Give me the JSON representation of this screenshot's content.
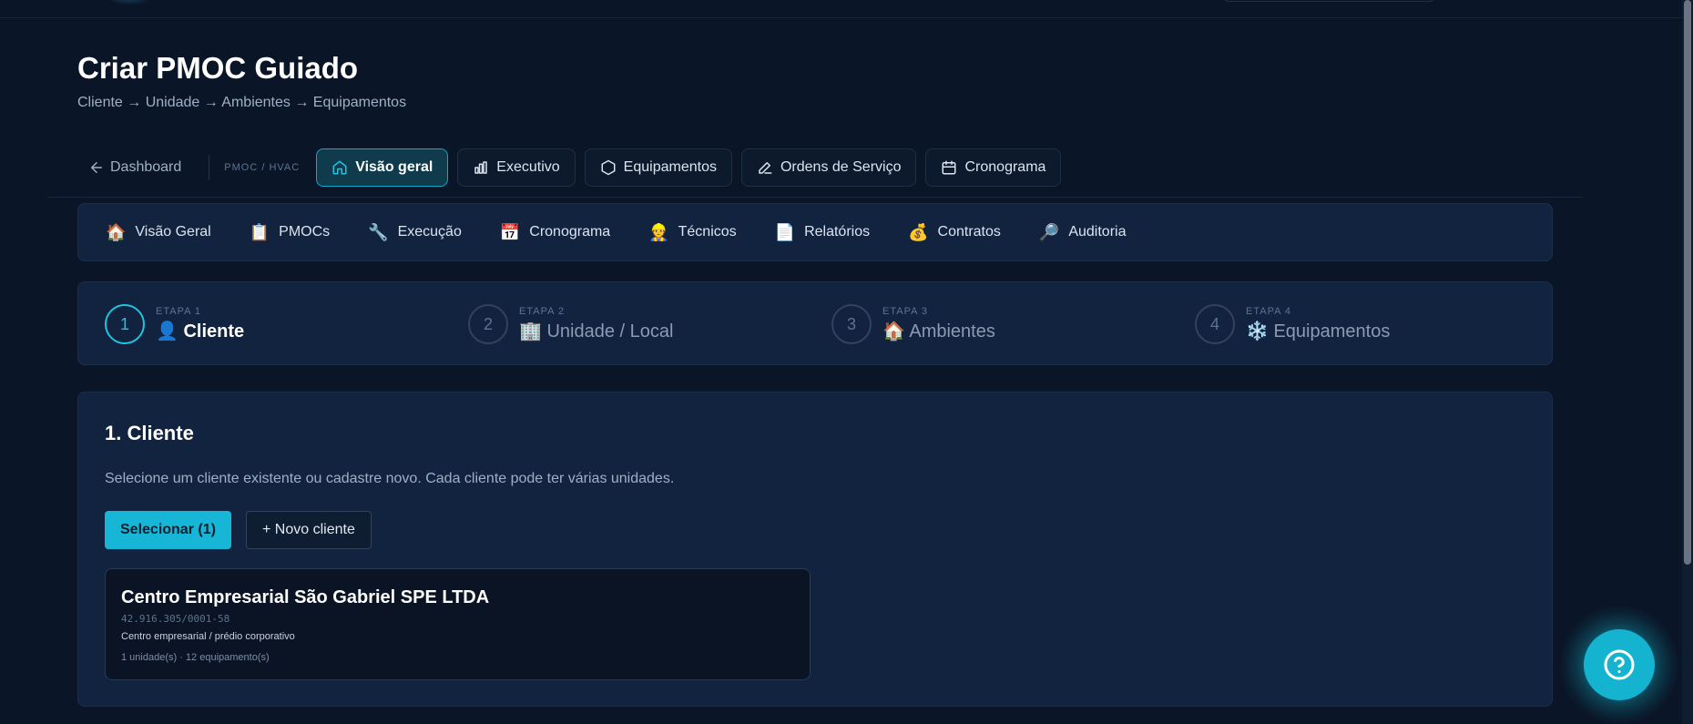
{
  "header": {
    "title": "Criar PMOC Guiado",
    "subtitle": "Cliente → Unidade → Ambientes → Equipamentos"
  },
  "nav": {
    "back_label": "Dashboard",
    "section_label": "PMOC / HVAC",
    "tabs": [
      {
        "label": "Visão geral",
        "icon": "home-icon",
        "active": true
      },
      {
        "label": "Executivo",
        "icon": "bar-chart-icon",
        "active": false
      },
      {
        "label": "Equipamentos",
        "icon": "hexagon-icon",
        "active": false
      },
      {
        "label": "Ordens de Serviço",
        "icon": "edit-icon",
        "active": false
      },
      {
        "label": "Cronograma",
        "icon": "calendar-icon",
        "active": false
      }
    ]
  },
  "modules": [
    {
      "emoji": "🏠",
      "label": "Visão Geral"
    },
    {
      "emoji": "📋",
      "label": "PMOCs"
    },
    {
      "emoji": "🔧",
      "label": "Execução"
    },
    {
      "emoji": "📅",
      "label": "Cronograma"
    },
    {
      "emoji": "👷",
      "label": "Técnicos"
    },
    {
      "emoji": "📄",
      "label": "Relatórios"
    },
    {
      "emoji": "💰",
      "label": "Contratos"
    },
    {
      "emoji": "🔎",
      "label": "Auditoria"
    }
  ],
  "steps": [
    {
      "number": "1",
      "etapa": "ETAPA 1",
      "emoji": "👤",
      "name": "Cliente",
      "active": true
    },
    {
      "number": "2",
      "etapa": "ETAPA 2",
      "emoji": "🏢",
      "name": "Unidade / Local",
      "active": false
    },
    {
      "number": "3",
      "etapa": "ETAPA 3",
      "emoji": "🏠",
      "name": "Ambientes",
      "active": false
    },
    {
      "number": "4",
      "etapa": "ETAPA 4",
      "emoji": "❄️",
      "name": "Equipamentos",
      "active": false
    }
  ],
  "section": {
    "title": "1. Cliente",
    "description": "Selecione um cliente existente ou cadastre novo. Cada cliente pode ter várias unidades.",
    "select_button": "Selecionar (1)",
    "new_button": "+ Novo cliente"
  },
  "client": {
    "name": "Centro Empresarial São Gabriel SPE LTDA",
    "cnpj": "42.916.305/0001-58",
    "type": "Centro empresarial / prédio corporativo",
    "stats": "1 unidade(s) · 12 equipamento(s)"
  },
  "colors": {
    "background": "#0a1628",
    "panel": "#12233f",
    "accent": "#17b6d6"
  }
}
